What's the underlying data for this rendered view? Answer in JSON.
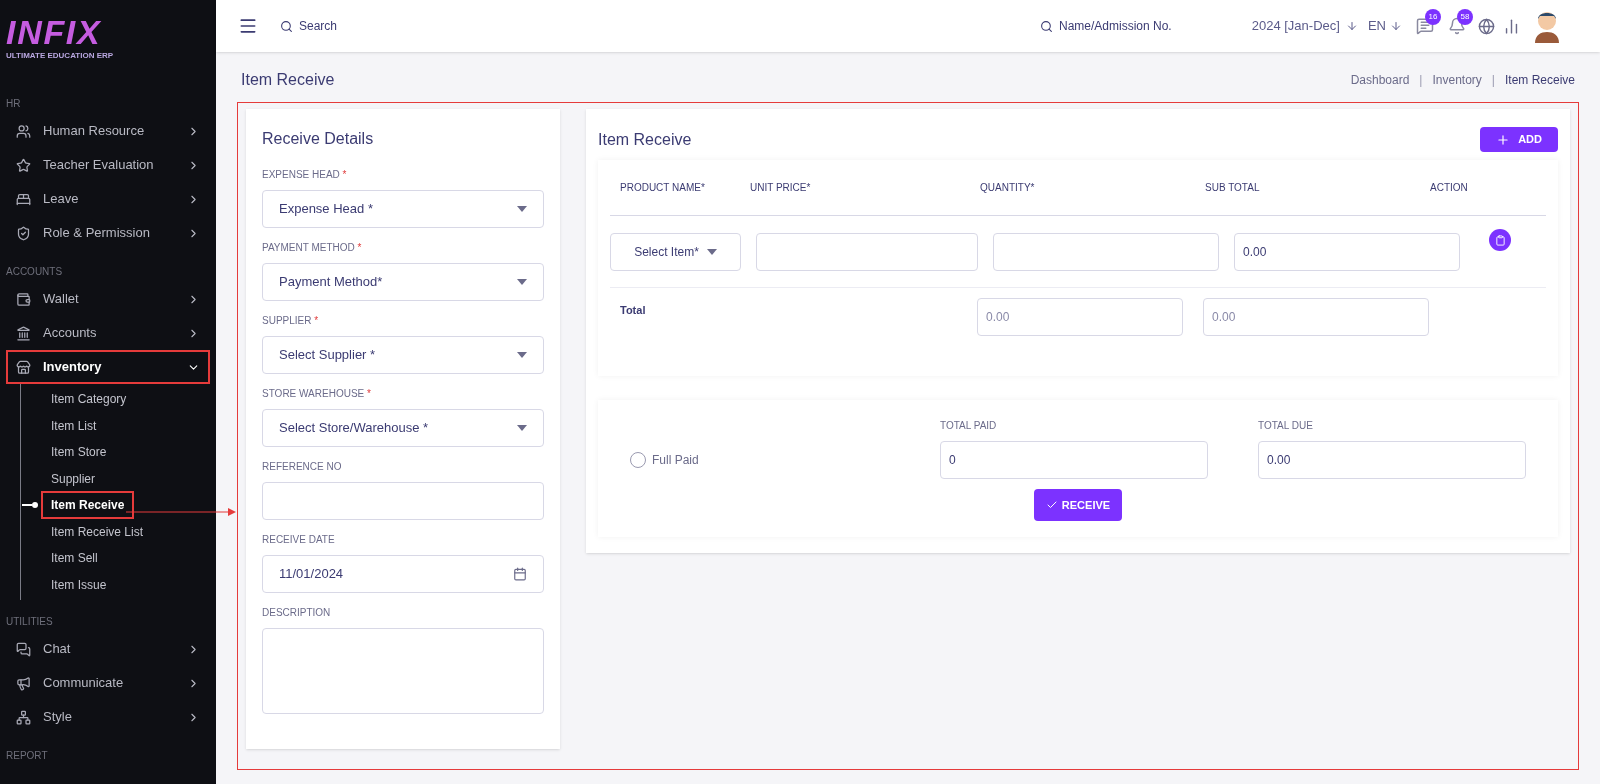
{
  "logo": {
    "name": "INFIX",
    "tagline": "ULTIMATE EDUCATION ERP"
  },
  "sidebar": {
    "sections": [
      {
        "heading": "HR",
        "items": [
          {
            "label": "Human Resource",
            "expanded": false,
            "highlighted": false
          },
          {
            "label": "Teacher Evaluation",
            "expanded": false,
            "highlighted": false
          },
          {
            "label": "Leave",
            "expanded": false,
            "highlighted": false
          },
          {
            "label": "Role & Permission",
            "expanded": false,
            "highlighted": false
          }
        ]
      },
      {
        "heading": "ACCOUNTS",
        "items": [
          {
            "label": "Wallet",
            "expanded": false,
            "highlighted": false
          },
          {
            "label": "Accounts",
            "expanded": false,
            "highlighted": false
          },
          {
            "label": "Inventory",
            "expanded": true,
            "highlighted": true,
            "children": [
              {
                "label": "Item Category",
                "selected": false
              },
              {
                "label": "Item List",
                "selected": false
              },
              {
                "label": "Item Store",
                "selected": false
              },
              {
                "label": "Supplier",
                "selected": false
              },
              {
                "label": "Item Receive",
                "selected": true
              },
              {
                "label": "Item Receive List",
                "selected": false
              },
              {
                "label": "Item Sell",
                "selected": false
              },
              {
                "label": "Item Issue",
                "selected": false
              }
            ]
          }
        ]
      },
      {
        "heading": "UTILITIES",
        "items": [
          {
            "label": "Chat",
            "expanded": false,
            "highlighted": false
          },
          {
            "label": "Communicate",
            "expanded": false,
            "highlighted": false
          },
          {
            "label": "Style",
            "expanded": false,
            "highlighted": false
          }
        ]
      },
      {
        "heading": "REPORT"
      }
    ]
  },
  "topbar": {
    "search_placeholder": "Search",
    "student_search": "Name/Admission No.",
    "year": "2024 [Jan-Dec]",
    "language": "EN",
    "messages_count": "16",
    "notifications_count": "58"
  },
  "page_title": "Item Receive",
  "breadcrumb": [
    "Dashboard",
    "Inventory",
    "Item Receive"
  ],
  "breadcrumb_separator": "|",
  "receive_details": {
    "title": "Receive Details",
    "fields": [
      {
        "kind": "select",
        "label": "EXPENSE HEAD",
        "required_mark": "*",
        "value": "Expense Head *"
      },
      {
        "kind": "select",
        "label": "PAYMENT METHOD",
        "required_mark": "*",
        "value": "Payment Method*"
      },
      {
        "kind": "select",
        "label": "SUPPLIER",
        "required_mark": "*",
        "value": "Select Supplier *"
      },
      {
        "kind": "select",
        "label": "STORE WAREHOUSE",
        "required_mark": "*",
        "value": "Select Store/Warehouse *"
      },
      {
        "kind": "text",
        "label": "REFERENCE NO"
      },
      {
        "kind": "date",
        "label": "RECEIVE DATE",
        "value": "11/01/2024"
      },
      {
        "kind": "textarea",
        "label": "DESCRIPTION"
      }
    ]
  },
  "item_receive": {
    "title": "Item Receive",
    "add_button": "ADD",
    "columns": [
      "PRODUCT NAME*",
      "UNIT PRICE*",
      "QUANTITY*",
      "SUB TOTAL",
      "ACTION"
    ],
    "row": {
      "product": "Select Item*",
      "sub_total": "0.00"
    },
    "total": {
      "label": "Total",
      "quantity": "0.00",
      "sub_total": "0.00"
    }
  },
  "payment": {
    "full_paid": {
      "label": "Full Paid",
      "checked": false
    },
    "total_paid_label": "TOTAL PAID",
    "total_paid": "0",
    "total_due_label": "TOTAL DUE",
    "total_due": "0.00",
    "receive_button": "RECEIVE"
  }
}
